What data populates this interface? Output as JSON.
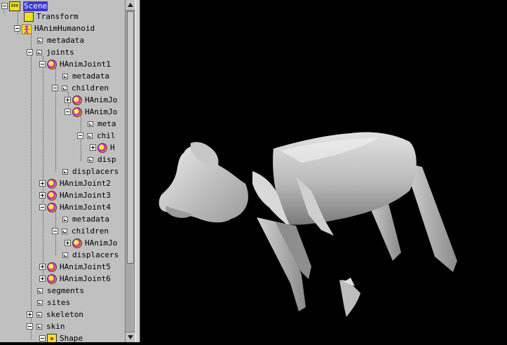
{
  "tree": {
    "nodes": [
      {
        "label": "Scene",
        "icon": "scene-icon",
        "toggle": "minus",
        "selected": true
      },
      {
        "label": "Transform",
        "icon": "transform-icon",
        "toggle": "none"
      },
      {
        "label": "HAnimHumanoid",
        "icon": "humanoid-icon",
        "toggle": "minus"
      },
      {
        "label": "metadata",
        "icon": "field-icon",
        "toggle": "none"
      },
      {
        "label": "joints",
        "icon": "field-icon",
        "toggle": "minus"
      },
      {
        "label": "HAnimJoint1",
        "icon": "joint-icon",
        "toggle": "minus"
      },
      {
        "label": "metadata",
        "icon": "field-icon",
        "toggle": "none"
      },
      {
        "label": "children",
        "icon": "field-icon",
        "toggle": "minus"
      },
      {
        "label": "HAnimJo",
        "icon": "joint-icon",
        "toggle": "plus"
      },
      {
        "label": "HAnimJo",
        "icon": "joint-icon",
        "toggle": "minus"
      },
      {
        "label": "meta",
        "icon": "field-icon",
        "toggle": "none"
      },
      {
        "label": "chil",
        "icon": "field-icon",
        "toggle": "minus"
      },
      {
        "label": "H",
        "icon": "joint-icon",
        "toggle": "plus"
      },
      {
        "label": "disp",
        "icon": "field-icon",
        "toggle": "none"
      },
      {
        "label": "displacers",
        "icon": "field-icon",
        "toggle": "none"
      },
      {
        "label": "HAnimJoint2",
        "icon": "joint-icon",
        "toggle": "plus"
      },
      {
        "label": "HAnimJoint3",
        "icon": "joint-icon",
        "toggle": "plus"
      },
      {
        "label": "HAnimJoint4",
        "icon": "joint-icon",
        "toggle": "minus"
      },
      {
        "label": "metadata",
        "icon": "field-icon",
        "toggle": "none"
      },
      {
        "label": "children",
        "icon": "field-icon",
        "toggle": "minus"
      },
      {
        "label": "HAnimJo",
        "icon": "joint-icon",
        "toggle": "plus"
      },
      {
        "label": "displacers",
        "icon": "field-icon",
        "toggle": "none"
      },
      {
        "label": "HAnimJoint5",
        "icon": "joint-icon",
        "toggle": "plus"
      },
      {
        "label": "HAnimJoint6",
        "icon": "joint-icon",
        "toggle": "plus"
      },
      {
        "label": "segments",
        "icon": "field-icon",
        "toggle": "none"
      },
      {
        "label": "sites",
        "icon": "field-icon",
        "toggle": "none"
      },
      {
        "label": "skeleton",
        "icon": "field-icon",
        "toggle": "plus"
      },
      {
        "label": "skin",
        "icon": "field-icon",
        "toggle": "minus"
      },
      {
        "label": "Shape",
        "icon": "shape-icon",
        "toggle": "minus"
      }
    ]
  },
  "colors": {
    "tree_background": "#c0c0c0",
    "selection": "#3a3acb",
    "viewport_background": "#000000",
    "model_fill": "#b8b8b8"
  }
}
